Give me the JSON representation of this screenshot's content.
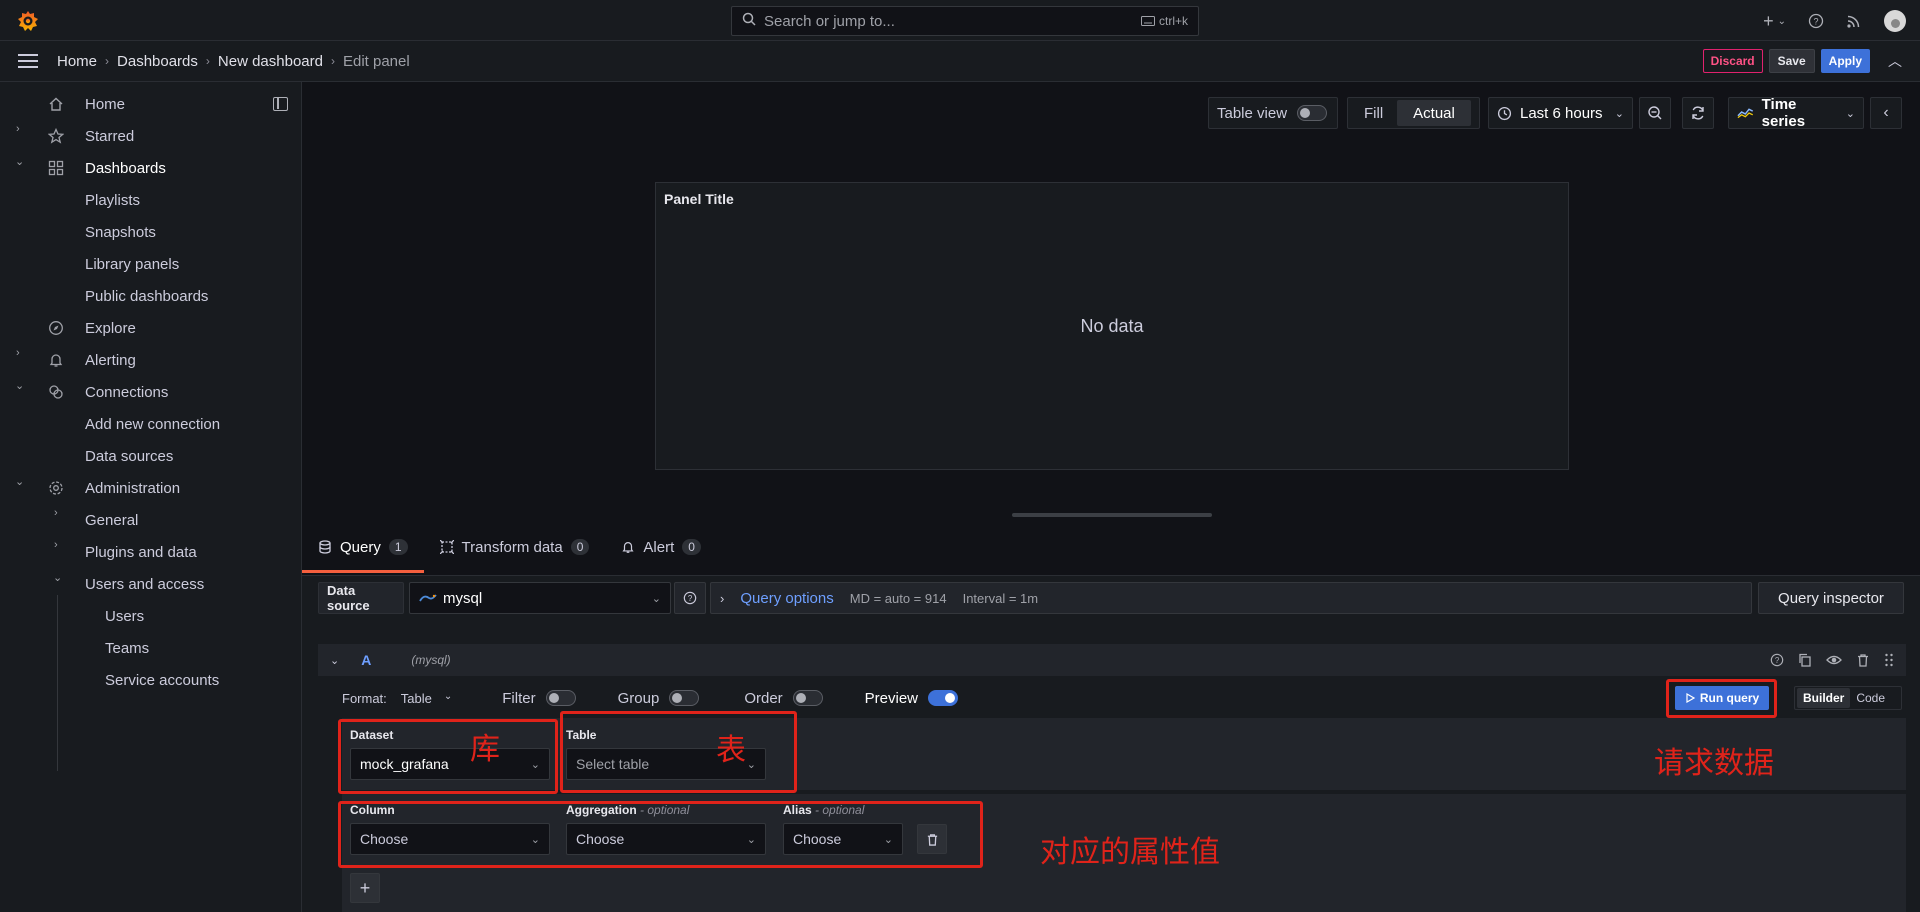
{
  "topbar": {
    "search_placeholder": "Search or jump to...",
    "search_shortcut": "ctrl+k"
  },
  "breadcrumb": [
    "Home",
    "Dashboards",
    "New dashboard",
    "Edit panel"
  ],
  "navbar": {
    "discard": "Discard",
    "save": "Save",
    "apply": "Apply"
  },
  "sidebar": {
    "items": [
      "Home",
      "Starred",
      "Dashboards",
      "Playlists",
      "Snapshots",
      "Library panels",
      "Public dashboards",
      "Explore",
      "Alerting",
      "Connections",
      "Add new connection",
      "Data sources",
      "Administration",
      "General",
      "Plugins and data",
      "Users and access",
      "Users",
      "Teams",
      "Service accounts"
    ]
  },
  "toolbar": {
    "table_view": "Table view",
    "fill": "Fill",
    "actual": "Actual",
    "time_range": "Last 6 hours",
    "viz": "Time series"
  },
  "panel": {
    "title": "Panel Title",
    "no_data": "No data"
  },
  "tabs": [
    {
      "label": "Query",
      "count": "1"
    },
    {
      "label": "Transform data",
      "count": "0"
    },
    {
      "label": "Alert",
      "count": "0"
    }
  ],
  "query": {
    "datasource_label": "Data source",
    "datasource_value": "mysql",
    "options_label": "Query options",
    "md": "MD = auto = 914",
    "interval": "Interval = 1m",
    "inspector": "Query inspector",
    "ref_id": "A",
    "ds_hint": "(mysql)",
    "format_label": "Format:",
    "format_value": "Table",
    "filter": "Filter",
    "group": "Group",
    "order": "Order",
    "preview": "Preview",
    "run": "Run query",
    "builder": "Builder",
    "code": "Code",
    "dataset_label": "Dataset",
    "dataset_value": "mock_grafana",
    "table_label": "Table",
    "table_placeholder": "Select table",
    "column_label": "Column",
    "aggregation_label": "Aggregation",
    "alias_label": "Alias",
    "optional": "- optional",
    "choose": "Choose"
  },
  "annotations": {
    "db": "库",
    "table": "表",
    "request": "请求数据",
    "attrs": "对应的属性值"
  },
  "colors": {
    "accent": "#3d71d9",
    "annotation": "#e0231a",
    "tab_active": "#f55f3e"
  }
}
